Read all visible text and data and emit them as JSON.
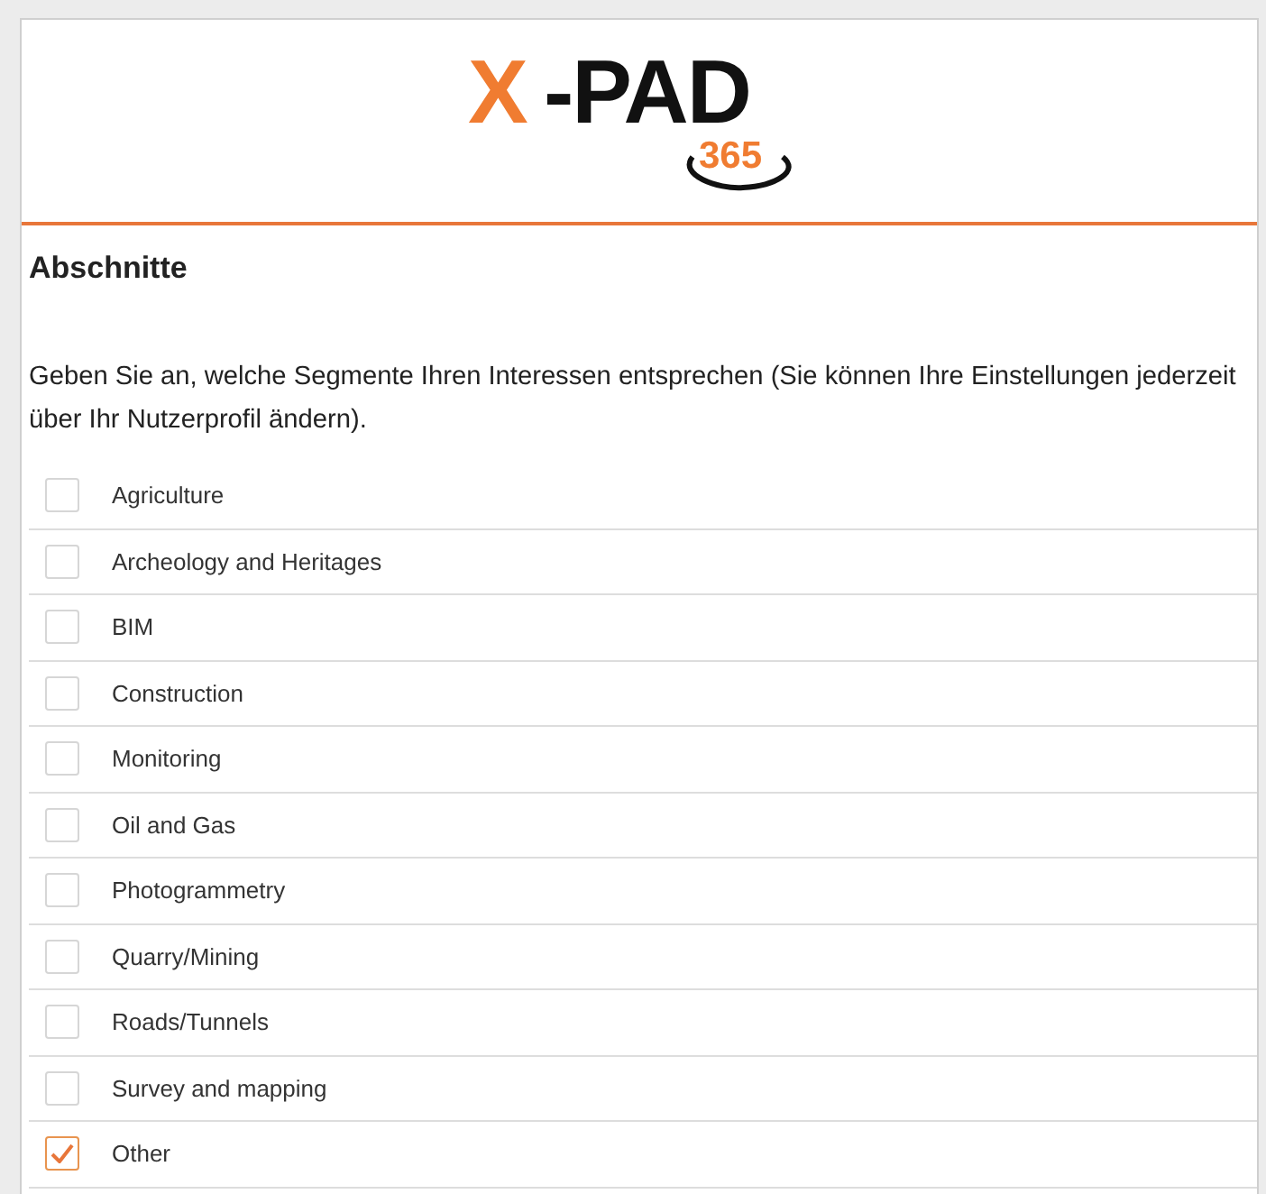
{
  "logo": {
    "mark": "X",
    "word": "-PAD",
    "badge": "365"
  },
  "section": {
    "title": "Abschnitte",
    "description": "Geben Sie an, welche Segmente Ihren Interessen entsprechen (Sie können Ihre Einstellungen jederzeit über Ihr Nutzerprofil ändern)."
  },
  "segments": [
    {
      "label": "Agriculture",
      "checked": false
    },
    {
      "label": "Archeology and Heritages",
      "checked": false
    },
    {
      "label": "BIM",
      "checked": false
    },
    {
      "label": "Construction",
      "checked": false
    },
    {
      "label": "Monitoring",
      "checked": false
    },
    {
      "label": "Oil and Gas",
      "checked": false
    },
    {
      "label": "Photogrammetry",
      "checked": false
    },
    {
      "label": "Quarry/Mining",
      "checked": false
    },
    {
      "label": "Roads/Tunnels",
      "checked": false
    },
    {
      "label": "Survey and mapping",
      "checked": false
    },
    {
      "label": "Other",
      "checked": true
    }
  ]
}
